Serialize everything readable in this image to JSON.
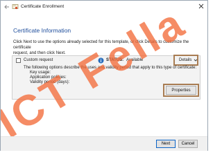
{
  "window": {
    "title": "Certificate Enrollment"
  },
  "page": {
    "heading": "Certificate Information",
    "intro_line1": "Click Next to use the options already selected for this template, or click Details to customize the certificate",
    "intro_line2": "request, and then click Next."
  },
  "request": {
    "name": "Custom request",
    "status_label": "STATUS:",
    "status_value": "Available",
    "details_label": "Details",
    "description": "The following options describe the uses and validity period that apply to this type of certificate:",
    "properties": [
      "Key usage:",
      "Application policies:",
      "Validity period (days):"
    ],
    "properties_button": "Properties"
  },
  "footer": {
    "next_label": "Next",
    "cancel_label": "Cancel"
  },
  "watermark": {
    "text": "ICT Fella"
  },
  "colors": {
    "heading": "#1f4e9c",
    "highlight_box": "#a87c52",
    "watermark": "#f26b3a",
    "status_icon": "#2a6ebd"
  }
}
